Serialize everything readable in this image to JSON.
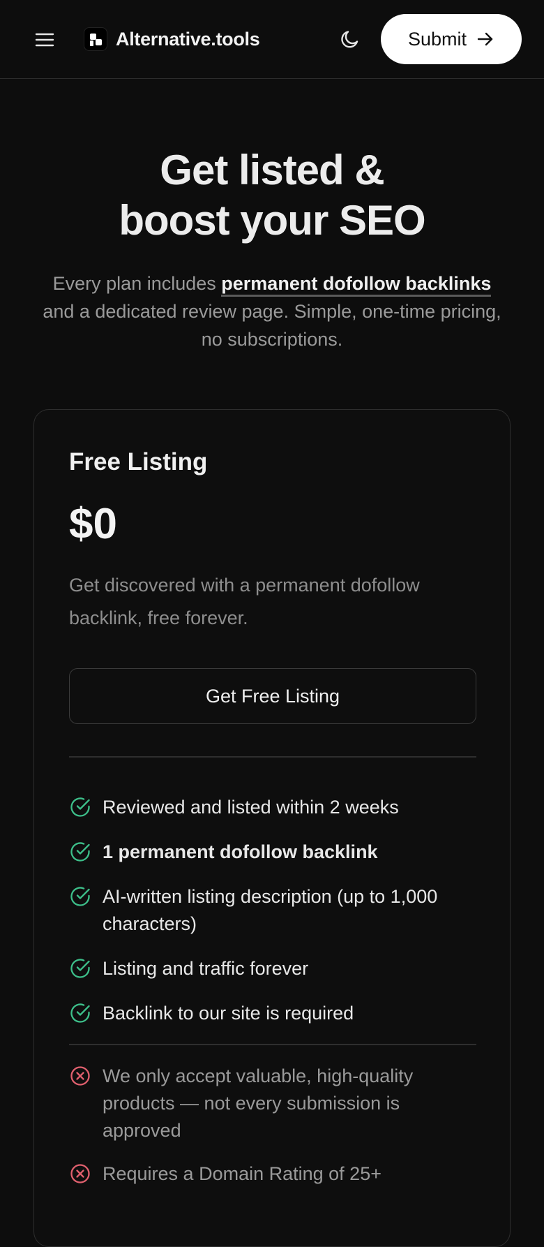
{
  "header": {
    "brand": "Alternative.tools",
    "submit_label": "Submit",
    "icons": {
      "menu": "menu-icon",
      "theme": "moon-icon",
      "submit_arrow": "arrow-right-icon"
    }
  },
  "hero": {
    "title_line1": "Get listed &",
    "title_line2": "boost your SEO",
    "sub_before": "Every plan includes ",
    "sub_highlight": "permanent dofollow backlinks",
    "sub_after": " and a dedicated review page. Simple, one-time pricing, no subscriptions."
  },
  "plan": {
    "name": "Free Listing",
    "price": "$0",
    "description": "Get discovered with a permanent dofollow backlink, free forever.",
    "cta_label": "Get Free Listing",
    "included": [
      "Reviewed and listed within 2 weeks",
      "1 permanent dofollow backlink",
      "AI-written listing description (up to 1,000 characters)",
      "Listing and traffic forever",
      "Backlink to our site is required"
    ],
    "excluded": [
      "We only accept valuable, high-quality products — not every submission is approved",
      "Requires a Domain Rating of 25+"
    ]
  },
  "colors": {
    "background": "#0d0d0d",
    "check": "#3dbf8a",
    "cross": "#e0606e"
  }
}
